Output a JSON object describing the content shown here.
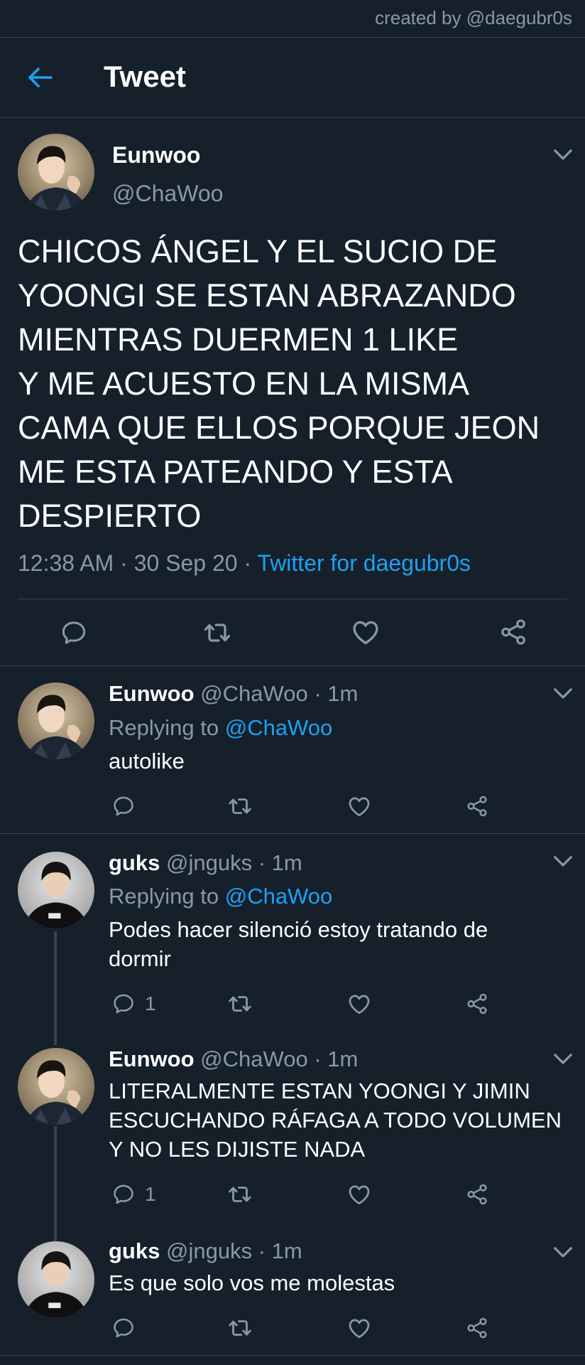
{
  "watermark": "created by @daegubr0s",
  "header": {
    "title": "Tweet",
    "back_icon": "arrow-left-icon"
  },
  "colors": {
    "background": "#15202b",
    "accent": "#1da1f2",
    "secondary_text": "#8899a6",
    "divider": "#38444d"
  },
  "main_tweet": {
    "name": "Eunwoo",
    "handle": "@ChaWoo",
    "text_lines": [
      "CHICOS ÁNGEL Y EL SUCIO DE",
      "YOONGI SE ESTAN ABRAZANDO",
      "MIENTRAS DUERMEN 1 LIKE",
      "Y ME ACUESTO EN LA MISMA",
      "CAMA QUE ELLOS PORQUE JEON",
      "ME ESTA PATEANDO Y ESTA",
      "DESPIERTO"
    ],
    "time": "12:38 AM",
    "date": "30 Sep 20",
    "separator": "·",
    "source": "Twitter for daegubr0s"
  },
  "replies": [
    {
      "name": "Eunwoo",
      "handle": "@ChaWoo",
      "time": "1m",
      "replying_prefix": "Replying to",
      "replying_to": "@ChaWoo",
      "text_lines": [
        "autolike"
      ],
      "reply_count": ""
    },
    {
      "name": "guks",
      "handle": "@jnguks",
      "time": "1m",
      "replying_prefix": "Replying to",
      "replying_to": "@ChaWoo",
      "text_lines": [
        "Podes hacer silenció estoy tratando de",
        "dormir"
      ],
      "reply_count": "1"
    },
    {
      "name": "Eunwoo",
      "handle": "@ChaWoo",
      "time": "1m",
      "text_lines": [
        "LITERALMENTE ESTAN YOONGI Y JIMIN",
        "ESCUCHANDO RÁFAGA A TODO VOLUMEN",
        "Y NO LES DIJISTE NADA"
      ],
      "reply_count": "1"
    },
    {
      "name": "guks",
      "handle": "@jnguks",
      "time": "1m",
      "text_lines": [
        "Es que solo vos me molestas"
      ],
      "reply_count": ""
    }
  ]
}
